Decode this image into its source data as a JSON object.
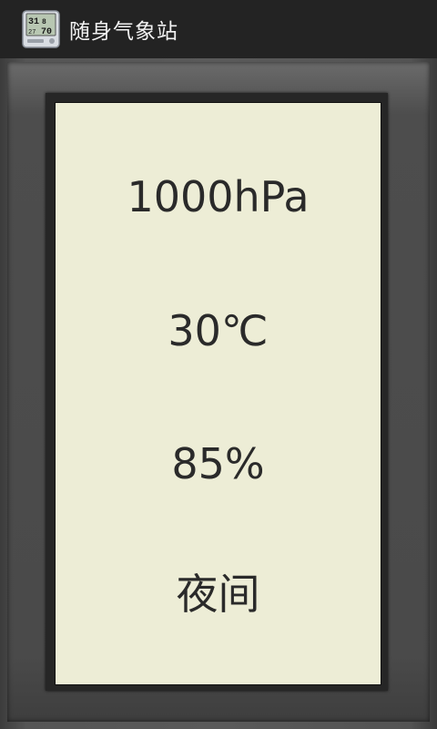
{
  "titlebar": {
    "title": "随身气象站",
    "icon": "thermometer-display-icon"
  },
  "display": {
    "pressure": "1000hPa",
    "temperature": "30℃",
    "humidity": "85%",
    "time_of_day": "夜间"
  },
  "colors": {
    "titlebar_bg": "#232323",
    "lcd_bg": "#ededd6",
    "frame": "#555555",
    "text": "#2a2a2a"
  }
}
